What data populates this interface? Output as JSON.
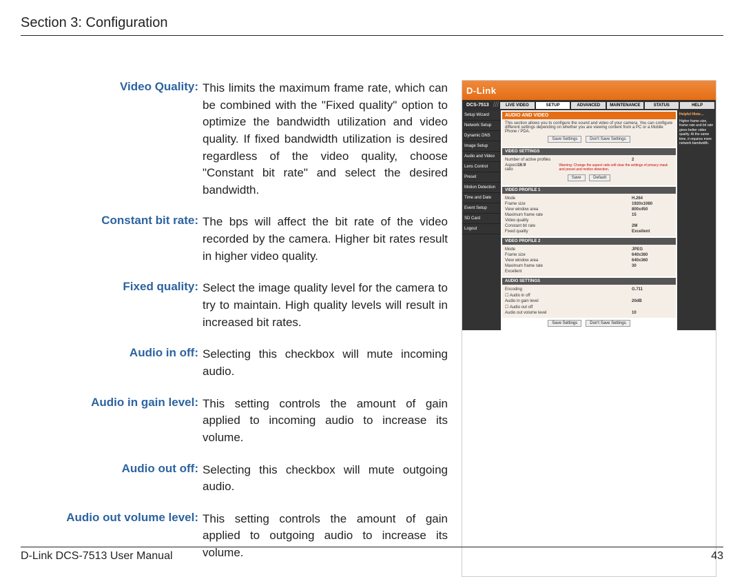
{
  "header": {
    "section_title": "Section 3: Configuration"
  },
  "definitions": [
    {
      "label": "Video Quality:",
      "text": "This limits the maximum frame rate, which can be combined with the \"Fixed quality\" option to optimize the bandwidth utilization and video quality. If fixed bandwidth utilization is desired regardless of the video quality, choose \"Constant bit rate\" and select the desired bandwidth."
    },
    {
      "label": "Constant bit rate:",
      "text": "The bps will affect the bit rate of the video recorded by the camera. Higher bit rates result in higher video quality."
    },
    {
      "label": "Fixed quality:",
      "text": "Select the image quality level for the camera to try to maintain. High quality levels will result in increased bit rates."
    },
    {
      "label": "Audio in off:",
      "text": "Selecting this checkbox will mute incoming audio."
    },
    {
      "label": "Audio in gain level:",
      "text": "This setting controls the amount of gain applied to incoming audio to increase its volume."
    },
    {
      "label": "Audio out off:",
      "text": "Selecting this checkbox will mute outgoing audio."
    },
    {
      "label": "Audio out volume level:",
      "text": "This setting controls the amount of gain applied to outgoing audio to increase its volume."
    }
  ],
  "figure": {
    "brand": "D-Link",
    "model": "DCS-7513",
    "tabs": [
      "LIVE VIDEO",
      "SETUP",
      "ADVANCED",
      "MAINTENANCE",
      "STATUS",
      "HELP"
    ],
    "active_tab": "SETUP",
    "sidebar": [
      "Setup Wizard",
      "Network Setup",
      "Dynamic DNS",
      "Image Setup",
      "Audio and Video",
      "Lens Control",
      "Preset",
      "Motion Detection",
      "Time and Date",
      "Event Setup",
      "SD Card",
      "Logout"
    ],
    "panel_title": "AUDIO AND VIDEO",
    "panel_intro": "This section allows you to configure the sound and video of your camera. You can configure different settings depending on whether you are viewing content from a PC or a Mobile Phone / PDA.",
    "save_btn": "Save Settings",
    "dont_save_btn": "Don't Save Settings",
    "default_btn": "Default",
    "video_settings": {
      "title": "VIDEO SETTINGS",
      "profiles_label": "Number of active profiles",
      "profiles_val": "2",
      "aspect_label": "Aspect ratio",
      "aspect_val": "16:9",
      "warning": "Warning: Change the aspect ratio will clear the settings of privacy mask and preset and motion detection."
    },
    "profile1": {
      "title": "VIDEO PROFILE 1",
      "rows": [
        {
          "l": "Mode",
          "v": "H.264"
        },
        {
          "l": "Frame size",
          "v": "1920x1080"
        },
        {
          "l": "View window area",
          "v": "800x450"
        },
        {
          "l": "Maximum frame rate",
          "v": "15"
        },
        {
          "l": "Video quality",
          "v": ""
        },
        {
          "l": "    Constant bit rate",
          "v": "2M"
        },
        {
          "l": "    Fixed quality",
          "v": "Excellent"
        }
      ]
    },
    "profile2": {
      "title": "VIDEO PROFILE 2",
      "rows": [
        {
          "l": "Mode",
          "v": "JPEG"
        },
        {
          "l": "Frame size",
          "v": "640x360"
        },
        {
          "l": "View window area",
          "v": "640x360"
        },
        {
          "l": "Maximum frame rate",
          "v": "30"
        },
        {
          "l": "Excellent",
          "v": ""
        }
      ]
    },
    "audio_settings": {
      "title": "AUDIO SETTINGS",
      "rows": [
        {
          "l": "Encoding",
          "v": "G.711"
        },
        {
          "l": "☐ Audio in off",
          "v": ""
        },
        {
          "l": "Audio in gain level",
          "v": "20dB"
        },
        {
          "l": "☐ Audio out off",
          "v": ""
        },
        {
          "l": "Audio out volume level",
          "v": "10"
        }
      ]
    },
    "help_title": "Helpful Hints…"
  },
  "footer": {
    "manual": "D-Link DCS-7513 User Manual",
    "page": "43"
  }
}
